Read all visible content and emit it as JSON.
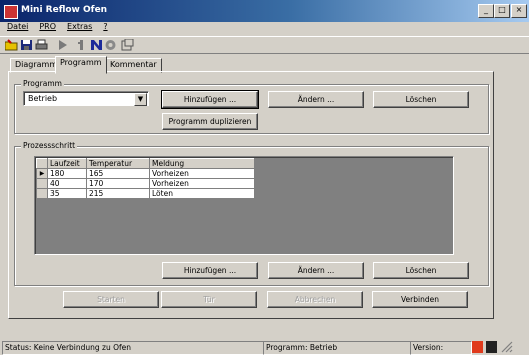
{
  "window": {
    "title": "Mini Reflow Ofen",
    "min": "_",
    "max": "□",
    "close": "×"
  },
  "menu": [
    "Datei",
    "PRO",
    "Extras",
    "?"
  ],
  "tabs": [
    "Diagramm",
    "Programm",
    "Kommentar"
  ],
  "programm": {
    "group_label": "Programm",
    "selected": "Betrieb",
    "add": "Hinzufügen ...",
    "change": "Ändern ...",
    "delete": "Löschen",
    "duplicate": "Programm duplizieren"
  },
  "prozess": {
    "group_label": "Prozessschritt",
    "columns": [
      "Laufzeit",
      "Temperatur",
      "Meldung"
    ],
    "rows": [
      {
        "laufzeit": "180",
        "temperatur": "165",
        "meldung": "Vorheizen"
      },
      {
        "laufzeit": "40",
        "temperatur": "170",
        "meldung": "Vorheizen"
      },
      {
        "laufzeit": "35",
        "temperatur": "215",
        "meldung": "Löten"
      }
    ],
    "add": "Hinzufügen ...",
    "change": "Ändern ...",
    "delete": "Löschen"
  },
  "actions": {
    "start": "Starten",
    "tuer": "Tür",
    "abort": "Abbrechen",
    "connect": "Verbinden"
  },
  "status": {
    "connection": "Status: Keine Verbindung zu Ofen",
    "program": "Programm: Betrieb",
    "version": "Version:"
  },
  "colors": {
    "title_start": "#0a246a",
    "title_end": "#a6caf0",
    "indicator_red": "#e03a1c",
    "indicator_dark": "#222222"
  }
}
